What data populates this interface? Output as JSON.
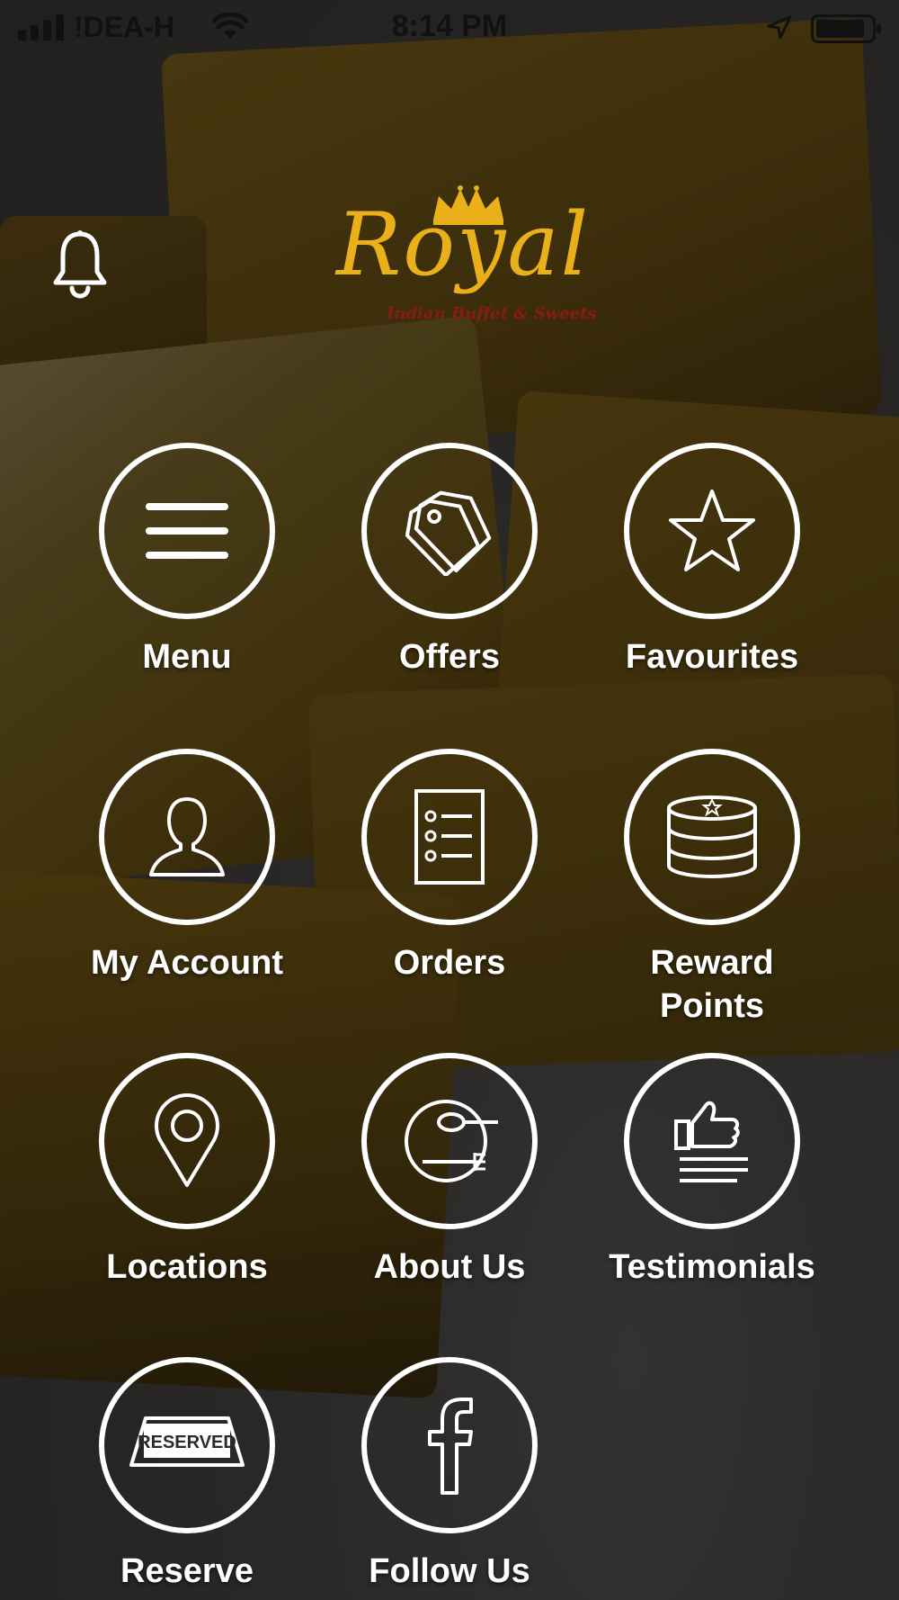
{
  "status_bar": {
    "carrier": "!DEA-H",
    "time": "8:14 PM"
  },
  "header": {
    "logo_text": "Royal",
    "logo_subtitle": "Indian Buffet & Sweets",
    "bell_icon": "bell-icon"
  },
  "menu": {
    "items": [
      {
        "label": "Menu",
        "icon": "hamburger-icon"
      },
      {
        "label": "Offers",
        "icon": "tags-icon"
      },
      {
        "label": "Favourites",
        "icon": "star-icon"
      },
      {
        "label": "My Account",
        "icon": "user-icon"
      },
      {
        "label": "Orders",
        "icon": "list-icon"
      },
      {
        "label": "Reward\nPoints",
        "icon": "coin-stack-icon"
      },
      {
        "label": "Locations",
        "icon": "map-pin-icon"
      },
      {
        "label": "About Us",
        "icon": "plate-cutlery-icon"
      },
      {
        "label": "Testimonials",
        "icon": "thumbs-up-icon"
      },
      {
        "label": "Reserve",
        "icon": "reserved-sign-icon",
        "icon_text": "RESERVED"
      },
      {
        "label": "Follow Us",
        "icon": "facebook-icon"
      }
    ]
  },
  "colors": {
    "logo_gold": "#e9b019",
    "logo_red": "#8a1b12",
    "icon_white": "#ffffff"
  }
}
